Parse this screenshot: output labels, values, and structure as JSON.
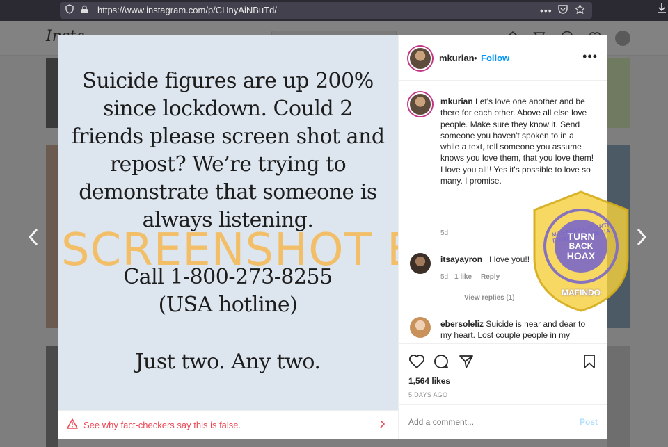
{
  "browser": {
    "url": "https://www.instagram.com/p/CHnyAiNBuTd/",
    "overflow_icon": "•••"
  },
  "page": {
    "logo_text": "Insta"
  },
  "post_image": {
    "lines": [
      "Suicide figures are up 200%",
      "since lockdown. Could 2",
      "friends please screen shot and",
      "repost? We’re trying to",
      "demonstrate that someone is",
      "always listening.",
      "Call 1-800-273-8255",
      "(USA hotline)",
      "Just two. Any two."
    ],
    "watermark": "SCREENSHOT BY"
  },
  "fact_check": {
    "text": "See why fact-checkers say this is false.",
    "color": "#ed4956"
  },
  "header": {
    "username": "mkurian",
    "separator": "•",
    "follow_label": "Follow",
    "more_label": "•••"
  },
  "caption": {
    "username": "mkurian",
    "text": "Let's love one another and be there for each other. Above all else love people. Make sure they know it. Send someone you haven't spoken to in a while a text, tell someone you assume knows you love them, that you love them! I love you all!! Yes it's possible to love so many. I promise.",
    "time": "5d"
  },
  "comments": [
    {
      "username": "itsayayron_",
      "text": "I love you!!",
      "time": "5d",
      "likes": "1 like",
      "reply": "Reply",
      "view_replies": "View replies (1)"
    },
    {
      "username": "ebersoleliz",
      "text": "Suicide is near and dear to my heart. Lost couple people in my lifetime and I have a past. Walking talking miracle right here and have heart for those facing it..."
    }
  ],
  "badge": {
    "ring_text": "MASYARAKAT ANTI FITNAH INDONESIA",
    "center_line1": "TURN",
    "center_line2": "BACK",
    "center_line3": "HOAX",
    "bottom": "MAFINDO"
  },
  "actions": {
    "likes": "1,564 likes",
    "date": "5 DAYS AGO",
    "comment_placeholder": "Add a comment...",
    "post_label": "Post"
  },
  "colors": {
    "accent": "#0095f6",
    "warning": "#ed4956",
    "watermark": "#f7b542",
    "badge_yellow": "#f4d03f",
    "badge_purple": "#7b68c8"
  }
}
